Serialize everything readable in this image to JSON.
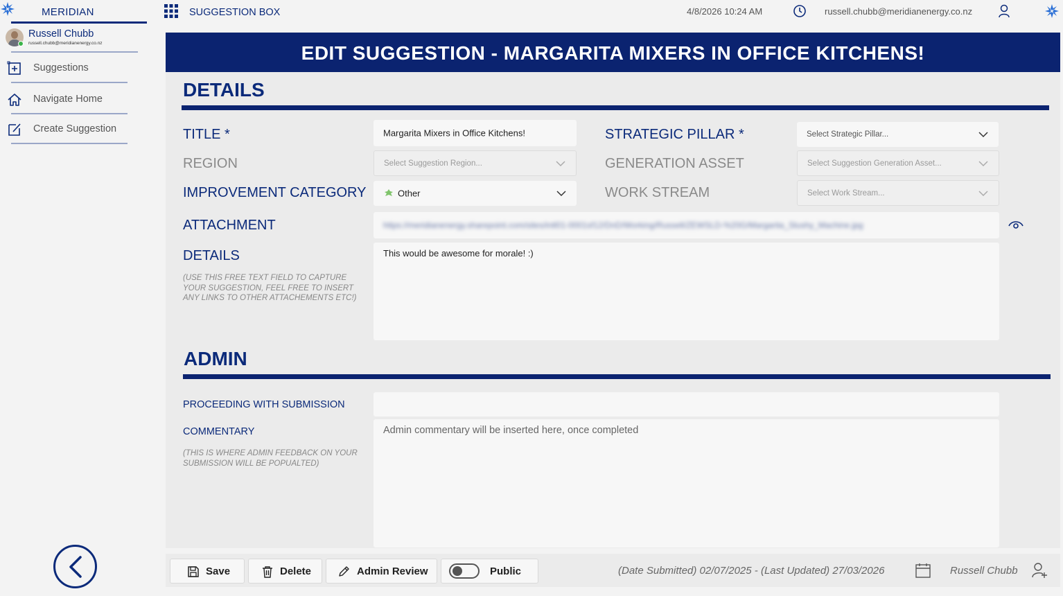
{
  "brand": {
    "name": "MERIDIAN"
  },
  "user": {
    "name": "Russell Chubb",
    "email": "russell.chubb@meridianenergy.co.nz"
  },
  "nav": [
    {
      "label": "Suggestions",
      "icon": "add-square-icon"
    },
    {
      "label": "Navigate Home",
      "icon": "home-icon"
    },
    {
      "label": "Create Suggestion",
      "icon": "edit-icon"
    }
  ],
  "topbar": {
    "app_title": "SUGGESTION BOX",
    "datetime": "4/8/2026 10:24 AM",
    "email": "russell.chubb@meridianenergy.co.nz"
  },
  "banner": {
    "title": "EDIT SUGGESTION - MARGARITA MIXERS IN OFFICE KITCHENS!"
  },
  "details": {
    "section_title": "DETAILS",
    "title_label": "TITLE *",
    "title_value": "Margarita Mixers in Office Kitchens!",
    "strategic_label": "STRATEGIC PILLAR *",
    "strategic_placeholder": "Select Strategic Pillar...",
    "region_label": "REGION",
    "region_placeholder": "Select Suggestion Region...",
    "generation_label": "GENERATION ASSET",
    "generation_placeholder": "Select Suggestion Generation Asset...",
    "category_label": "IMPROVEMENT CATEGORY",
    "category_value": "Other",
    "workstream_label": "WORK STREAM",
    "workstream_placeholder": "Select Work Stream...",
    "attachment_label": "ATTACHMENT",
    "attachment_value": "https://meridianenergy.sharepoint.com/sites/intl01-0001sf12/DnD/Working/Russell/ZEWSLD-%20G/Margarita_Slushy_Machine.jpg",
    "details_label": "DETAILS",
    "details_hint": "(USE THIS FREE TEXT FIELD TO CAPTURE YOUR SUGGESTION, FEEL FREE TO INSERT ANY LINKS TO OTHER ATTACHEMENTS ETC!)",
    "details_value": "This would be awesome for morale! :)"
  },
  "admin": {
    "section_title": "ADMIN",
    "proceeding_label": "PROCEEDING WITH SUBMISSION",
    "proceeding_value": "",
    "commentary_label": "COMMENTARY",
    "commentary_hint": "(THIS IS WHERE ADMIN FEEDBACK ON YOUR SUBMISSION WILL BE POPUALTED)",
    "commentary_placeholder": "Admin commentary will be inserted here, once completed"
  },
  "footer": {
    "save_label": "Save",
    "delete_label": "Delete",
    "admin_review_label": "Admin Review",
    "public_label": "Public",
    "public_on": false,
    "dates": "(Date Submitted) 02/07/2025 - (Last Updated) 27/03/2026",
    "user": "Russell Chubb"
  },
  "colors": {
    "brand_navy": "#0b2370",
    "brand_text": "#0b2a7a",
    "background": "#f3f3f3",
    "panel": "#ebebeb"
  }
}
